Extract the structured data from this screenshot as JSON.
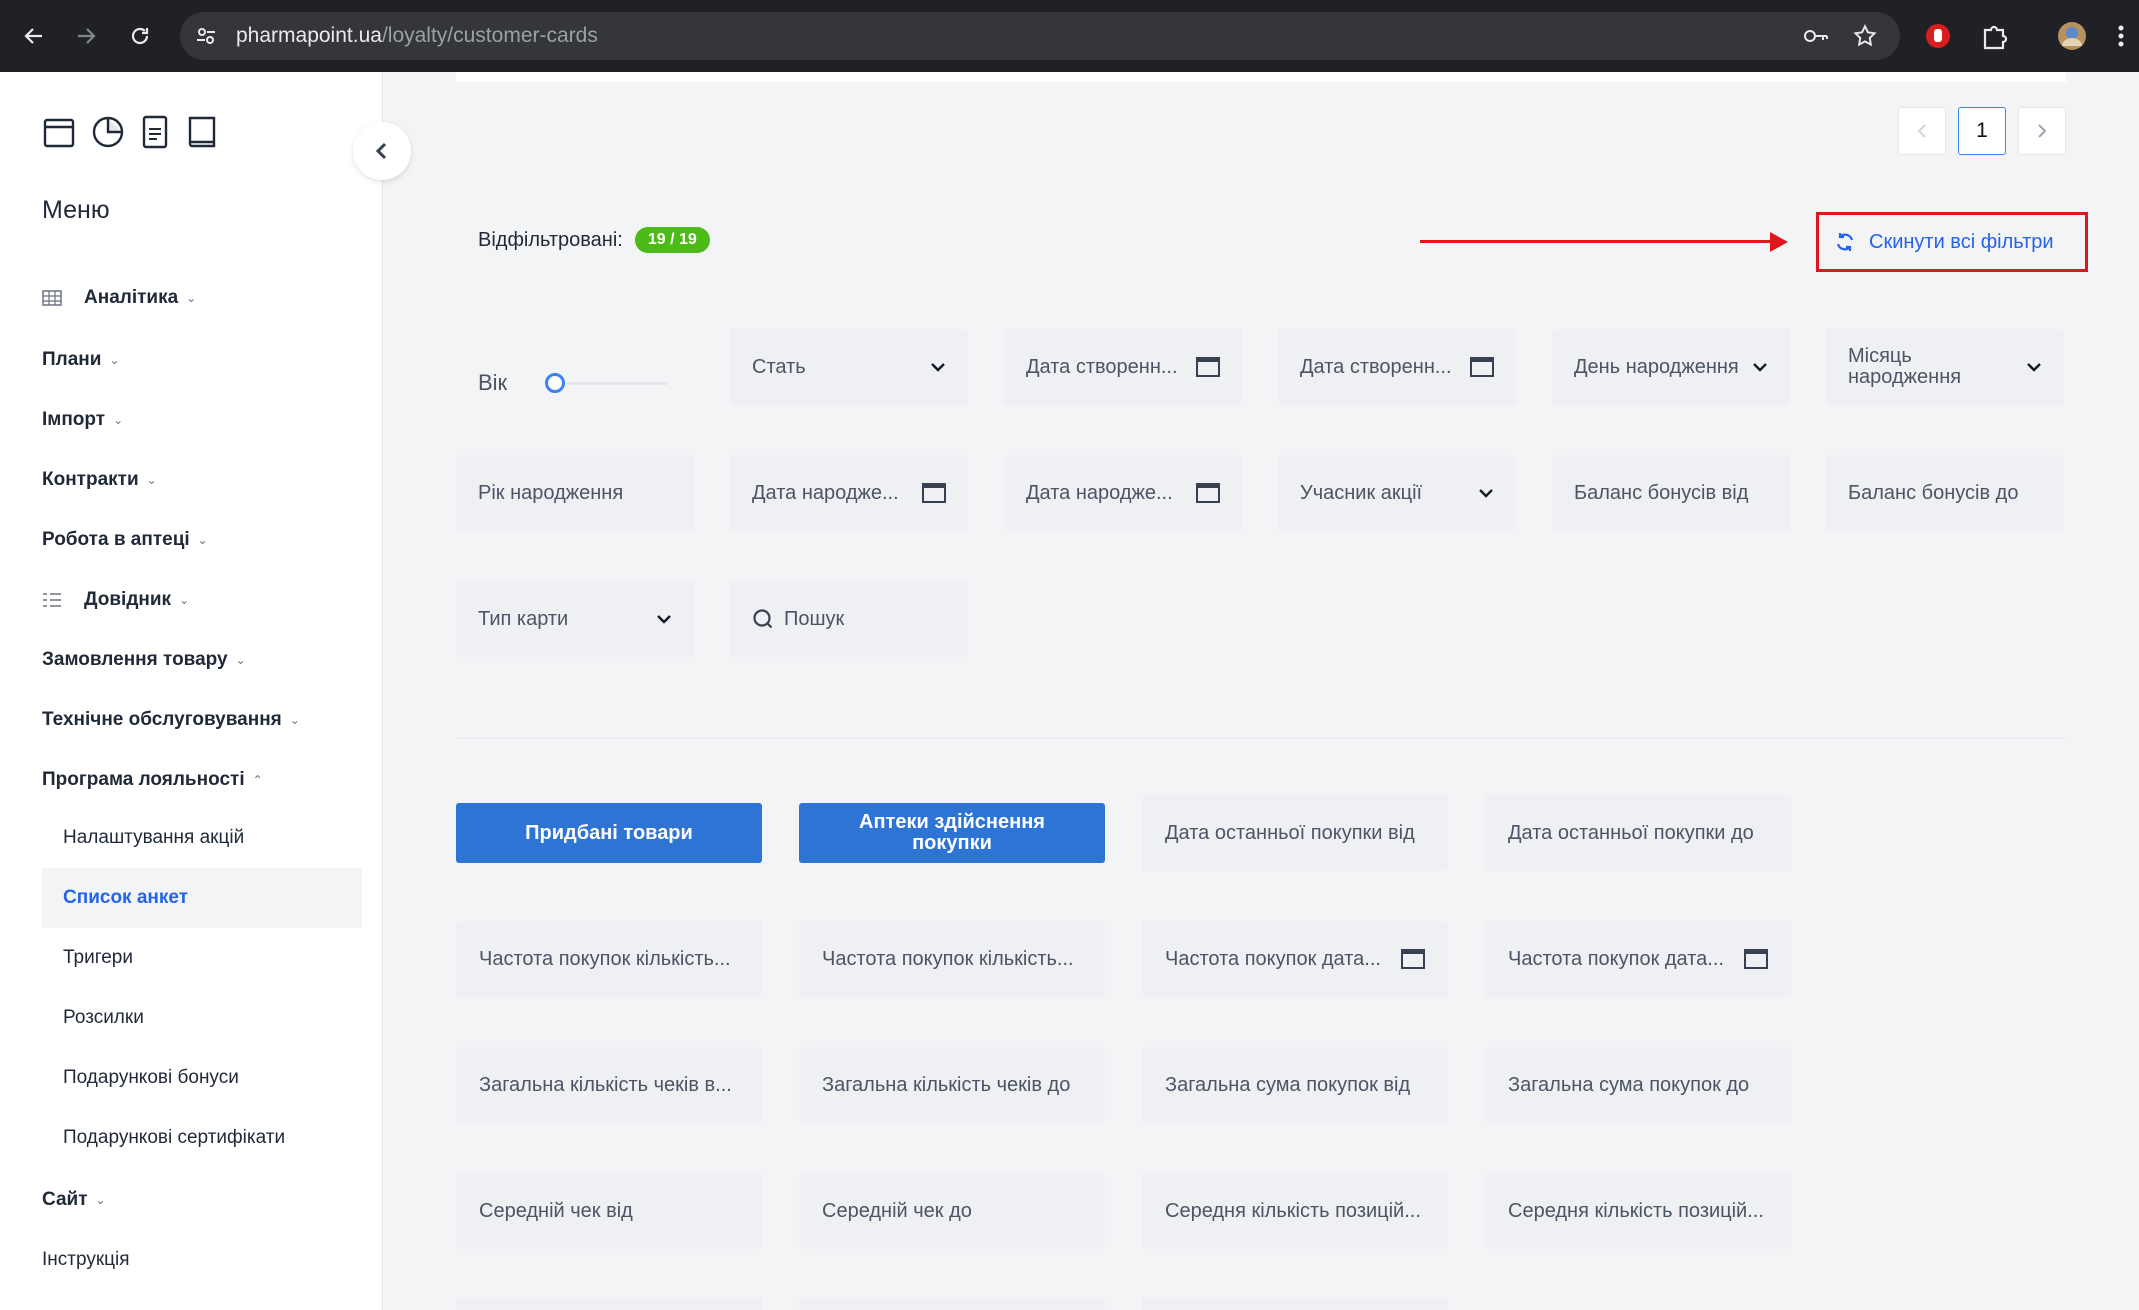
{
  "browser": {
    "url_host": "pharmapoint.ua",
    "url_path": "/loyalty/customer-cards"
  },
  "sidebar": {
    "menu_title": "Меню",
    "items": [
      {
        "label": "Аналітика",
        "has_icon": true
      },
      {
        "label": "Плани"
      },
      {
        "label": "Імпорт"
      },
      {
        "label": "Контракти"
      },
      {
        "label": "Робота в аптеці"
      },
      {
        "label": "Довідник",
        "has_icon": true
      },
      {
        "label": "Замовлення товару"
      },
      {
        "label": "Технічне обслуговування"
      },
      {
        "label": "Програма лояльності",
        "expanded": true
      },
      {
        "label": "Сайт"
      },
      {
        "label": "Інструкція"
      }
    ],
    "subitems": [
      {
        "label": "Налаштування акцій"
      },
      {
        "label": "Список анкет",
        "active": true
      },
      {
        "label": "Тригери"
      },
      {
        "label": "Розсилки"
      },
      {
        "label": "Подарункові бонуси"
      },
      {
        "label": "Подарункові сертифікати"
      }
    ]
  },
  "pagination": {
    "current": "1"
  },
  "filters": {
    "filtered_label": "Відфільтровані:",
    "filtered_count": "19 / 19",
    "reset_label": "Скинути всі фільтри",
    "age_label": "Вік",
    "row1": [
      "Стать",
      "Дата створенн...",
      "Дата створенн...",
      "День народження",
      "Місяць народження"
    ],
    "row2": [
      "Рік народження",
      "Дата народже...",
      "Дата народже...",
      "Учасник акції",
      "Баланс бонусів від",
      "Баланс бонусів до"
    ],
    "row3": [
      "Тип карти",
      "Пошук"
    ]
  },
  "purchase_filters": {
    "button_products": "Придбані товари",
    "button_pharmacies": "Аптеки здійснення покупки",
    "last_purchase_from": "Дата останньої покупки від",
    "last_purchase_to": "Дата останньої покупки до",
    "row2": [
      "Частота покупок кількість...",
      "Частота покупок кількість...",
      "Частота покупок дата...",
      "Частота покупок дата..."
    ],
    "row3": [
      "Загальна кількість чеків в...",
      "Загальна кількість чеків до",
      "Загальна сума покупок від",
      "Загальна сума покупок до"
    ],
    "row4": [
      "Середній чек від",
      "Середній чек до",
      "Середня кількість позицій...",
      "Середня кількість позицій..."
    ]
  },
  "colors": {
    "accent_blue": "#2e74d4",
    "badge_green": "#4cbb17",
    "annotation_red": "#e0161d"
  }
}
